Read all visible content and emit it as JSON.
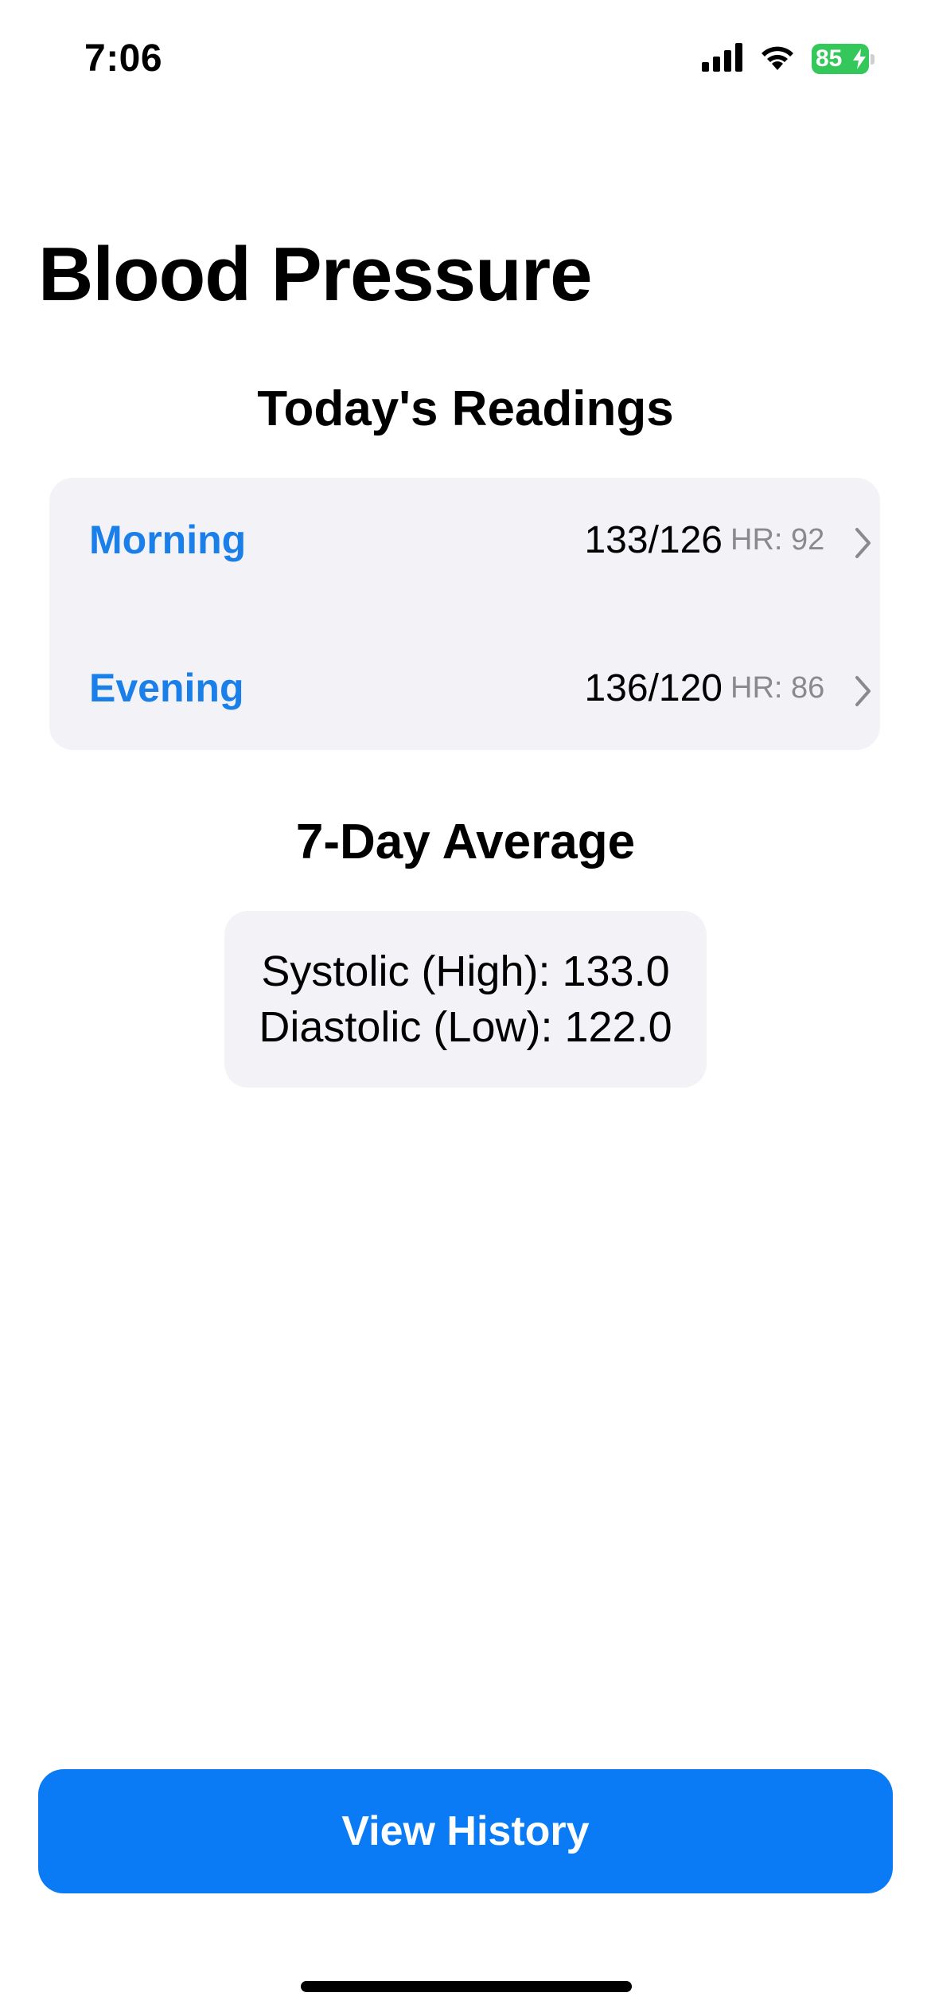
{
  "status_bar": {
    "time": "7:06",
    "battery": "85",
    "icons": [
      "cellular-signal-icon",
      "wifi-icon",
      "battery-charging-icon"
    ]
  },
  "header": {
    "title": "Blood Pressure"
  },
  "today": {
    "heading": "Today's Readings",
    "readings": [
      {
        "label": "Morning",
        "value": "133/126",
        "hr": "HR: 92"
      },
      {
        "label": "Evening",
        "value": "136/120",
        "hr": "HR: 86"
      }
    ]
  },
  "average": {
    "heading": "7-Day Average",
    "systolic": "Systolic (High): 133.0",
    "diastolic": "Diastolic (Low): 122.0"
  },
  "actions": {
    "view_history": "View History"
  },
  "colors": {
    "accent": "#0a7bf5",
    "label_blue": "#1a7fe8",
    "card_bg": "#f2f2f7",
    "secondary_text": "#8a8a8e",
    "battery": "#34c759"
  }
}
